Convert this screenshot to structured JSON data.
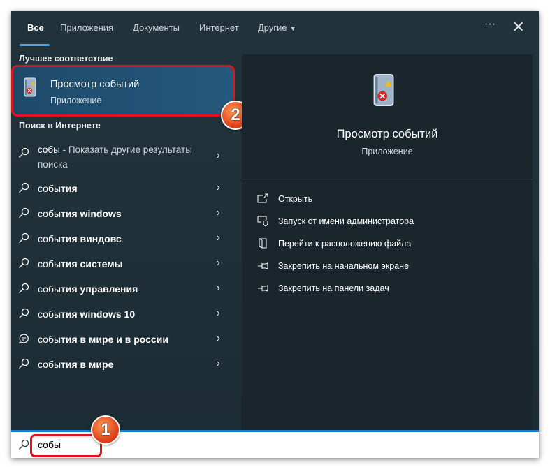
{
  "tabs": [
    {
      "label": "Все"
    },
    {
      "label": "Приложения"
    },
    {
      "label": "Документы"
    },
    {
      "label": "Интернет"
    },
    {
      "label": "Другие"
    }
  ],
  "tabs_more": "···",
  "close": "✕",
  "best_match": {
    "heading": "Лучшее соответствие",
    "title": "Просмотр событий",
    "subtitle": "Приложение",
    "badge": "2"
  },
  "web": {
    "heading": "Поиск в Интернете",
    "first": {
      "query": "собы",
      "desc": " - Показать другие результаты",
      "desc2": "поиска"
    },
    "items": [
      {
        "pre": "собы",
        "rest": "тия",
        "icon": "search-icon"
      },
      {
        "pre": "собы",
        "rest": "тия windows",
        "icon": "search-icon"
      },
      {
        "pre": "собы",
        "rest": "тия виндовс",
        "icon": "search-icon"
      },
      {
        "pre": "собы",
        "rest": "тия системы",
        "icon": "search-icon"
      },
      {
        "pre": "собы",
        "rest": "тия управления",
        "icon": "search-icon"
      },
      {
        "pre": "собы",
        "rest": "тия windows 10",
        "icon": "search-icon"
      },
      {
        "pre": "собы",
        "rest": "тия в мире и в россии",
        "icon": "chat-icon"
      },
      {
        "pre": "собы",
        "rest": "тия в мире",
        "icon": "search-icon"
      }
    ]
  },
  "detail": {
    "title": "Просмотр событий",
    "subtitle": "Приложение",
    "actions": [
      {
        "label": "Открыть"
      },
      {
        "label": "Запуск от имени администратора"
      },
      {
        "label": "Перейти к расположению файла"
      },
      {
        "label": "Закрепить на начальном экране"
      },
      {
        "label": "Закрепить на панели задач"
      }
    ]
  },
  "search": {
    "value": "собы",
    "badge": "1"
  },
  "chevron": "›"
}
